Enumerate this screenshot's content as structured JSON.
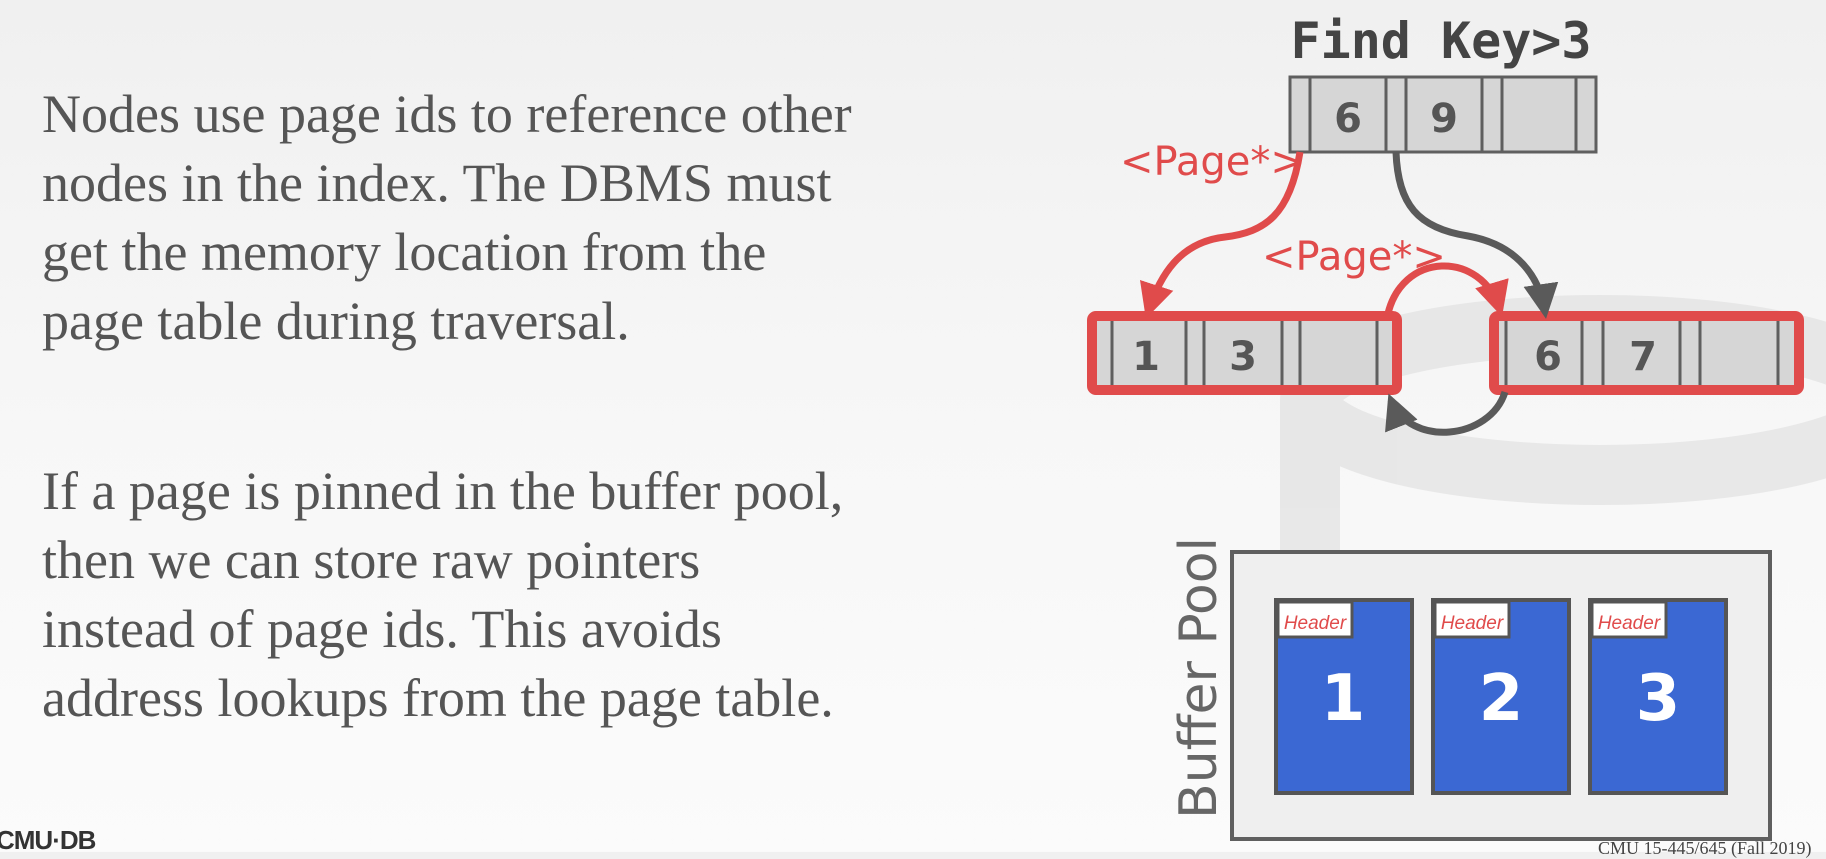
{
  "paragraphs": [
    "Nodes use page ids to reference other\nnodes in the index. The DBMS must\nget the memory location from the\npage table during traversal.",
    "If a page is pinned in the buffer pool,\nthen we can store raw pointers\ninstead of page ids. This avoids\naddress lookups from the page table."
  ],
  "diagram": {
    "query_title": "Find Key>3",
    "root_keys": [
      "6",
      "9"
    ],
    "leaf_left_keys": [
      "1",
      "3"
    ],
    "leaf_right_keys": [
      "6",
      "7"
    ],
    "pointer_label_left": "<Page*>",
    "pointer_label_center": "<Page*>",
    "buffer_pool_label": "Buffer Pool",
    "page_header_label": "Header",
    "pages": [
      "1",
      "2",
      "3"
    ]
  },
  "colors": {
    "highlight_red": "#e04b4b",
    "arrow_gray": "#5a5a5a",
    "node_fill": "#d6d6d6",
    "page_blue": "#3b68d3"
  },
  "footer": {
    "logo": "CMU·DB",
    "course": "CMU 15-445/645 (Fall 2019)"
  }
}
